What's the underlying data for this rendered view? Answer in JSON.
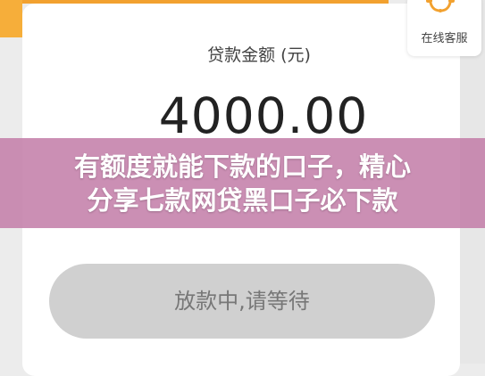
{
  "customer_service": {
    "label": "在线客服",
    "icon": "customer-service-headset-icon",
    "color": "#f2a12f"
  },
  "loan": {
    "label": "贷款金额 (元)",
    "amount": "4000.00"
  },
  "overlay": {
    "line1": "有额度就能下款的口子，精心",
    "line2": "分享七款网贷黑口子必下款"
  },
  "button": {
    "label": "放款中,请等待"
  },
  "colors": {
    "accent": "#f2a12f",
    "banner": "#c480aa",
    "button_bg": "#d0d0d0"
  }
}
